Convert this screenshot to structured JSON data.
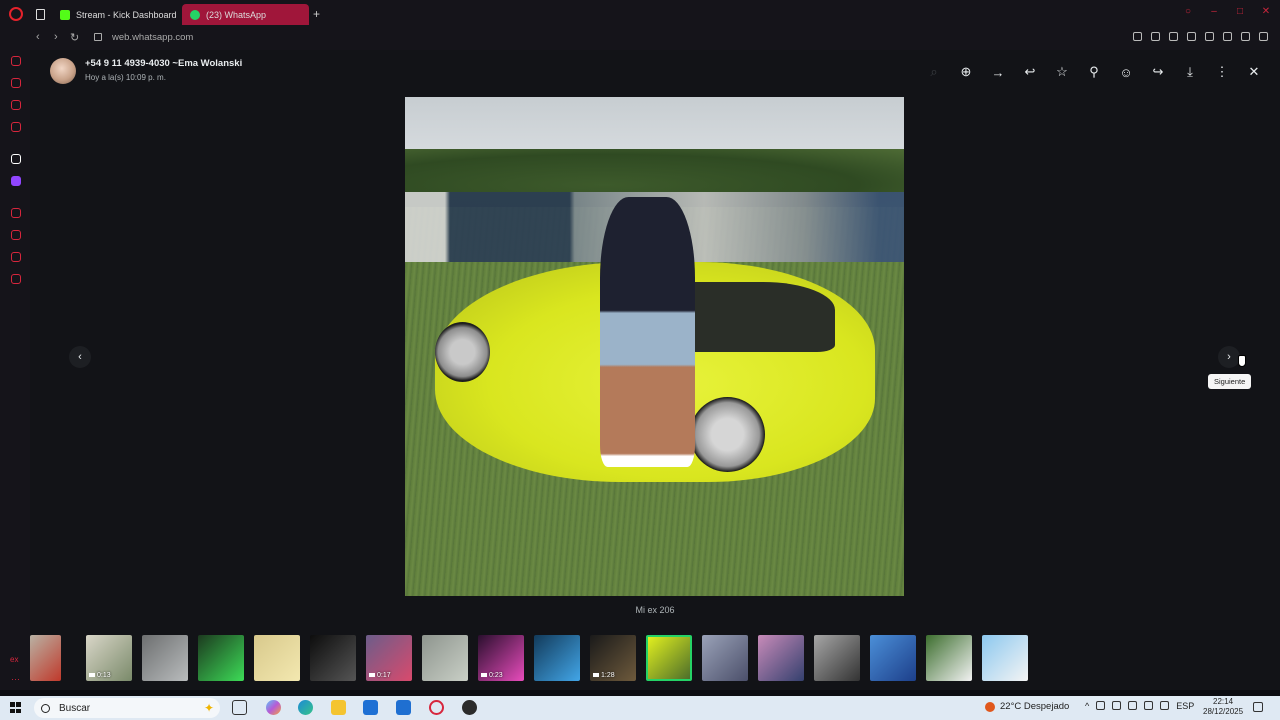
{
  "browser": {
    "tabs": [
      {
        "label": "Stream - Kick Dashboard"
      },
      {
        "label": "(23) WhatsApp"
      }
    ],
    "url": "web.whatsapp.com",
    "new_tab": "+"
  },
  "viewer": {
    "contact_name": "+54 9 11 4939-4030 ~Ema Wolanski",
    "timestamp": "Hoy a la(s) 10:09 p. m.",
    "caption": "Mi ex 206",
    "tooltip_next": "Siguiente",
    "toolbar_icons": [
      "zoom-out-icon",
      "zoom-in-icon",
      "go-to-message-icon",
      "reply-icon",
      "star-icon",
      "pin-icon",
      "react-icon",
      "forward-icon",
      "download-icon",
      "menu-icon",
      "close-icon"
    ],
    "thumbnails": [
      {
        "duration": "",
        "colors": [
          "#b9b2a4",
          "#c0392b"
        ]
      },
      {
        "duration": "0:13",
        "colors": [
          "#d9d6c8",
          "#7a8a6a"
        ]
      },
      {
        "duration": "",
        "colors": [
          "#6d6f70",
          "#b9bcbd"
        ]
      },
      {
        "duration": "",
        "colors": [
          "#1c3a1f",
          "#3ddc57"
        ]
      },
      {
        "duration": "",
        "colors": [
          "#d8c98c",
          "#f3e8b0"
        ]
      },
      {
        "duration": "",
        "colors": [
          "#0d0d0d",
          "#555"
        ]
      },
      {
        "duration": "0:17",
        "colors": [
          "#6c5d8a",
          "#d94a6d"
        ]
      },
      {
        "duration": "",
        "colors": [
          "#8e958e",
          "#c9cfc6"
        ]
      },
      {
        "duration": "0:23",
        "colors": [
          "#2a0f2e",
          "#e84cbc"
        ]
      },
      {
        "duration": "",
        "colors": [
          "#123a5a",
          "#42a6e8"
        ]
      },
      {
        "duration": "1:28",
        "colors": [
          "#1a1a1a",
          "#6e5a3c"
        ]
      },
      {
        "duration": "",
        "colors": [
          "#e1ef1f",
          "#4d6e2a"
        ],
        "selected": true
      },
      {
        "duration": "",
        "colors": [
          "#9aa2b8",
          "#4b4f6a"
        ]
      },
      {
        "duration": "",
        "colors": [
          "#c88bb9",
          "#34406e"
        ]
      },
      {
        "duration": "",
        "colors": [
          "#a6a6a6",
          "#333"
        ]
      },
      {
        "duration": "",
        "colors": [
          "#4b8fd8",
          "#1d3f8a"
        ]
      },
      {
        "duration": "",
        "colors": [
          "#3c6e2e",
          "#f2f2f2"
        ]
      },
      {
        "duration": "",
        "colors": [
          "#8cc8ef",
          "#f4f4f4"
        ]
      }
    ]
  },
  "taskbar": {
    "search_placeholder": "Buscar",
    "weather": "22°C  Despejado",
    "lang": "ESP",
    "time": "22:14",
    "date": "28/12/2025"
  },
  "sidebar_extra": {
    "label": "ex"
  }
}
